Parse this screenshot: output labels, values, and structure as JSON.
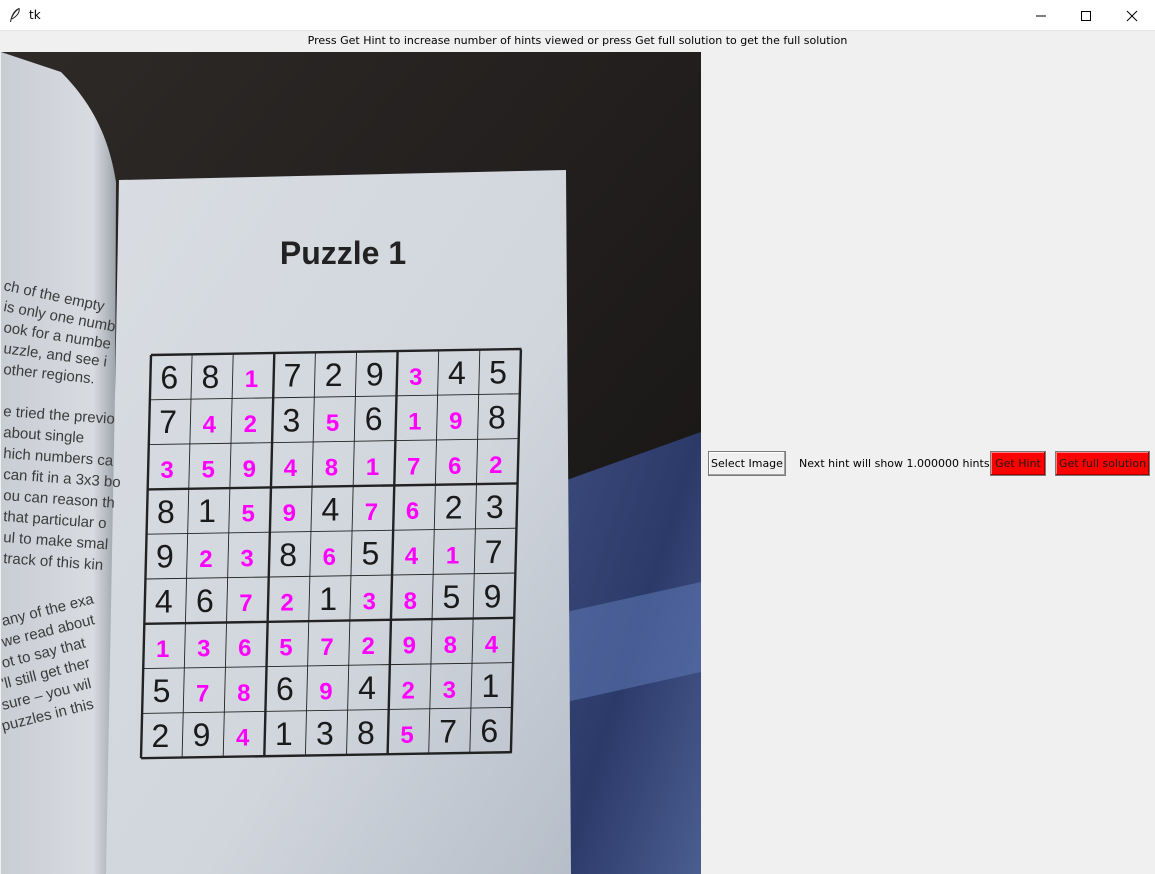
{
  "window": {
    "title": "tk",
    "icon": "feather-icon",
    "controls": [
      "minimize-icon",
      "maximize-icon",
      "close-icon"
    ]
  },
  "instructions": "Press Get Hint to increase number of hints viewed or press Get full solution to get the full solution",
  "image": {
    "puzzle_title": "Puzzle 1",
    "given_color": "#1a1a1a",
    "hint_color": "#ff00ff",
    "grid": [
      [
        "6",
        "8",
        "1",
        "7",
        "2",
        "9",
        "3",
        "4",
        "5"
      ],
      [
        "7",
        "4",
        "2",
        "3",
        "5",
        "6",
        "1",
        "9",
        "8"
      ],
      [
        "3",
        "5",
        "9",
        "4",
        "8",
        "1",
        "7",
        "6",
        "2"
      ],
      [
        "8",
        "1",
        "5",
        "9",
        "4",
        "7",
        "6",
        "2",
        "3"
      ],
      [
        "9",
        "2",
        "3",
        "8",
        "6",
        "5",
        "4",
        "1",
        "7"
      ],
      [
        "4",
        "6",
        "7",
        "2",
        "1",
        "3",
        "8",
        "5",
        "9"
      ],
      [
        "1",
        "3",
        "6",
        "5",
        "7",
        "2",
        "9",
        "8",
        "4"
      ],
      [
        "5",
        "7",
        "8",
        "6",
        "9",
        "4",
        "2",
        "3",
        "1"
      ],
      [
        "2",
        "9",
        "4",
        "1",
        "3",
        "8",
        "5",
        "7",
        "6"
      ]
    ],
    "hints": [
      [
        0,
        0,
        1,
        0,
        0,
        0,
        1,
        0,
        0
      ],
      [
        0,
        1,
        1,
        0,
        1,
        0,
        1,
        1,
        0
      ],
      [
        1,
        1,
        1,
        1,
        1,
        1,
        1,
        1,
        1
      ],
      [
        0,
        0,
        1,
        1,
        0,
        1,
        1,
        0,
        0
      ],
      [
        0,
        1,
        1,
        0,
        1,
        0,
        1,
        1,
        0
      ],
      [
        0,
        0,
        1,
        1,
        0,
        1,
        1,
        0,
        0
      ],
      [
        1,
        1,
        1,
        1,
        1,
        1,
        1,
        1,
        1
      ],
      [
        0,
        1,
        1,
        0,
        1,
        0,
        1,
        1,
        0
      ],
      [
        0,
        0,
        1,
        0,
        0,
        0,
        1,
        0,
        0
      ]
    ],
    "left_page_text": [
      "ch of the empty",
      "is only one numb",
      "ook for a numbe",
      "uzzle, and see i",
      "other regions.",
      "",
      "e tried the previo",
      "about single",
      "hich numbers ca",
      "can fit in a 3x3 bo",
      "ou can reason th",
      "that particular o",
      "ul to make smal",
      "track of this kin",
      "",
      "",
      "any of the exa",
      "we read about",
      "ot to say that",
      "'ll still get ther",
      "sure – you wil",
      "puzzles in this"
    ]
  },
  "controls": {
    "select_image_label": "Select Image",
    "hint_status": "Next hint will show 1.000000 hints",
    "get_hint_label": "Get Hint",
    "get_full_solution_label": "Get full solution",
    "button_accent": "#ff0000"
  }
}
